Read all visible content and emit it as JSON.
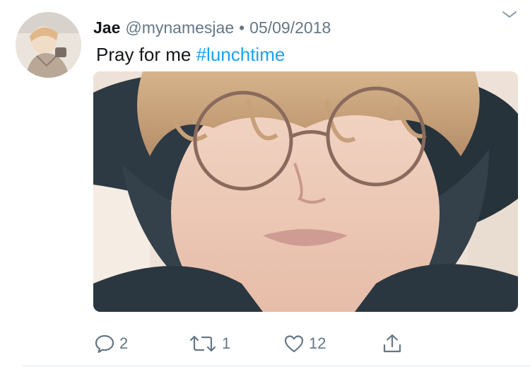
{
  "tweet": {
    "author_name": "Jae",
    "handle": "@mynamesjae",
    "separator": "•",
    "date": "05/09/2018",
    "text_prefix": "Pray for me ",
    "hashtag": "#lunchtime"
  },
  "actions": {
    "reply_count": "2",
    "retweet_count": "1",
    "like_count": "12"
  },
  "icons": {
    "menu": "chevron-down-icon",
    "reply": "speech-bubble-icon",
    "retweet": "retweet-arrows-icon",
    "like": "heart-outline-icon",
    "share": "share-upload-icon"
  },
  "colors": {
    "text": "#14171a",
    "secondary": "#657786",
    "link": "#1da1f2",
    "divider": "#e1e8ed"
  }
}
